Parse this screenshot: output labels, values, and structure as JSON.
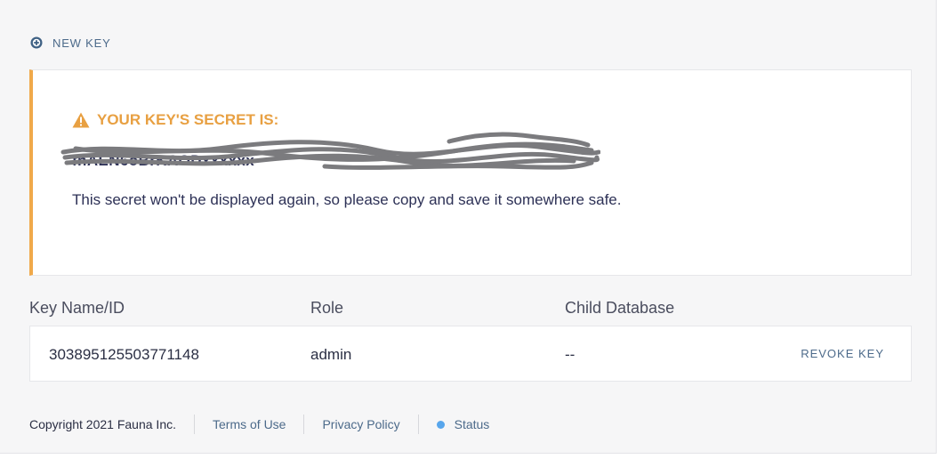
{
  "new_key": {
    "label": "NEW KEY",
    "icon": "plus-circle-icon"
  },
  "secret": {
    "title": "YOUR KEY'S SECRET IS:",
    "value": "fnAEN6oBrKAODxxxxxx",
    "warning": "This secret won't be displayed again, so please copy and save it somewhere safe.",
    "accent_color": "#f0a94a",
    "icon": "warning-icon"
  },
  "table": {
    "headers": [
      "Key Name/ID",
      "Role",
      "Child Database"
    ],
    "rows": [
      {
        "id": "303895125503771148",
        "role": "admin",
        "child_db": "--",
        "action": "REVOKE KEY"
      }
    ]
  },
  "footer": {
    "copyright": "Copyright 2021 Fauna Inc.",
    "terms": "Terms of Use",
    "privacy": "Privacy Policy",
    "status": "Status",
    "status_color": "#58a6ec"
  }
}
